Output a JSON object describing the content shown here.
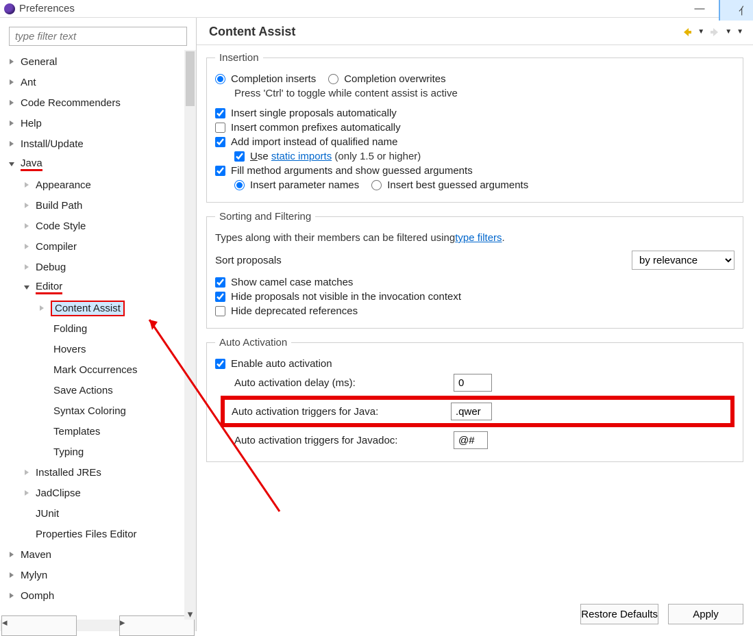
{
  "window": {
    "title": "Preferences"
  },
  "sidebar": {
    "filter_placeholder": "type filter text",
    "items": {
      "general": "General",
      "ant": "Ant",
      "code_recommenders": "Code Recommenders",
      "help": "Help",
      "install_update": "Install/Update",
      "java": "Java",
      "appearance": "Appearance",
      "build_path": "Build Path",
      "code_style": "Code Style",
      "compiler": "Compiler",
      "debug": "Debug",
      "editor": "Editor",
      "content_assist": "Content Assist",
      "folding": "Folding",
      "hovers": "Hovers",
      "mark_occurrences": "Mark Occurrences",
      "save_actions": "Save Actions",
      "syntax_coloring": "Syntax Coloring",
      "templates": "Templates",
      "typing": "Typing",
      "installed_jres": "Installed JREs",
      "jadclipse": "JadClipse",
      "junit": "JUnit",
      "properties_files_editor": "Properties Files Editor",
      "maven": "Maven",
      "mylyn": "Mylyn",
      "oomph": "Oomph"
    }
  },
  "page": {
    "title": "Content Assist",
    "insertion": {
      "legend": "Insertion",
      "completion_inserts": "Completion inserts",
      "completion_overwrites": "Completion overwrites",
      "toggle_note": "Press 'Ctrl' to toggle while content assist is active",
      "insert_single": "Insert single proposals automatically",
      "insert_common": "Insert common prefixes automatically",
      "add_import": "Add import instead of qualified name",
      "use_pre": "U",
      "use_post": "se ",
      "static_imports": "static imports",
      "static_imports_post": " (only 1.5 or higher)",
      "fill_method": "Fill method arguments and show guessed arguments",
      "insert_param": "Insert parameter names",
      "insert_best": "Insert best guessed arguments"
    },
    "sorting": {
      "legend": "Sorting and Filtering",
      "types_along_pre": "Types along with their members can be filtered using ",
      "type_filters": "type filters",
      "sort_label": "Sort proposals",
      "sort_value": "by relevance",
      "show_camel": "Show camel case matches",
      "hide_proposals": "Hide proposals not visible in the invocation context",
      "hide_deprecated": "Hide deprecated references"
    },
    "auto": {
      "legend": "Auto Activation",
      "enable": "Enable auto activation",
      "delay_label": "Auto activation delay (ms):",
      "delay_value": "0",
      "java_label": "Auto activation triggers for Java:",
      "java_value": ".qwer",
      "javadoc_label": "Auto activation triggers for Javadoc:",
      "javadoc_value": "@#"
    },
    "buttons": {
      "restore": "Restore Defaults",
      "apply": "Apply"
    }
  }
}
